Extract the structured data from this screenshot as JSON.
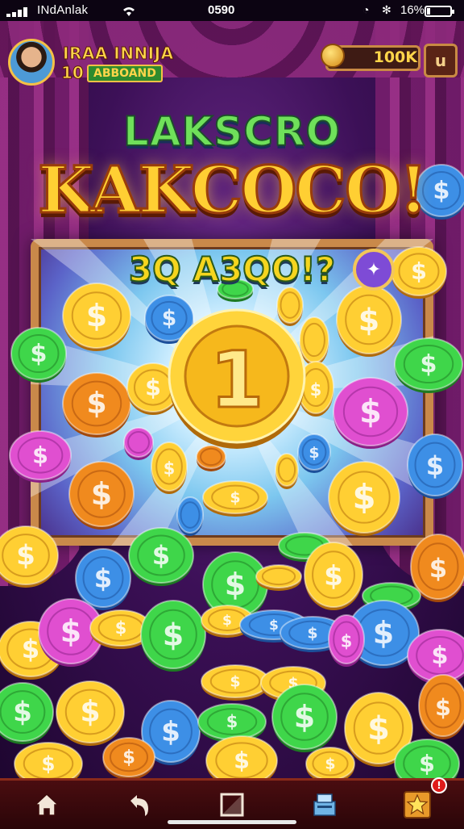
{
  "status_bar": {
    "carrier": "INdAnlak",
    "time": "0590",
    "battery_text": "16%",
    "battery_level": 0.16,
    "icons": [
      "signal-icon",
      "wifi-icon",
      "alarm-icon",
      "bluetooth-icon",
      "battery-icon"
    ]
  },
  "player": {
    "name": "IRAA INNIJA",
    "level": "10",
    "tag": "ABBOAND"
  },
  "balance": {
    "value": "100K",
    "icon": "coin-icon"
  },
  "menu_button": {
    "label": "u",
    "icon": "menu-icon"
  },
  "banner": {
    "line1": "LAKSCRO",
    "line2": "KAKCOCO!",
    "line3": "3Q A3QO!?"
  },
  "colors": {
    "gold": "#ffcf33",
    "green": "#3fd64a",
    "blue": "#3d8fe6",
    "pink": "#e04fd0",
    "orange": "#f08a1e",
    "curtain": "#8e2a7c",
    "nav": "#4a0d10"
  },
  "coins": {
    "symbol": "$",
    "center_symbol": "1"
  },
  "bottom_nav": {
    "items": [
      {
        "name": "home",
        "icon": "home-icon"
      },
      {
        "name": "back",
        "icon": "back-arrow-icon"
      },
      {
        "name": "square",
        "icon": "square-icon"
      },
      {
        "name": "shop",
        "icon": "cash-register-icon"
      },
      {
        "name": "rewards",
        "icon": "star-icon",
        "badge": "!"
      }
    ]
  }
}
